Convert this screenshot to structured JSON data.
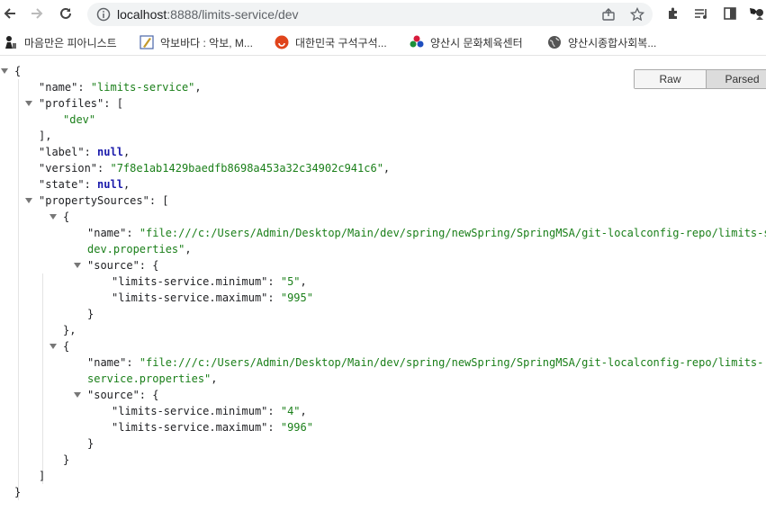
{
  "browser": {
    "url_host": "localhost",
    "url_rest": ":8888/limits-service/dev"
  },
  "bookmarks": [
    {
      "label": "마음만은 피아니스트",
      "icon": "person-icon"
    },
    {
      "label": "악보바다 : 악보, M...",
      "icon": "pen-icon"
    },
    {
      "label": "대한민국 구석구석...",
      "icon": "red-circle-icon"
    },
    {
      "label": "양산시 문화체육센터",
      "icon": "flower-icon"
    },
    {
      "label": "양산시종합사회복...",
      "icon": "globe-icon"
    }
  ],
  "view_toggle": {
    "raw": "Raw",
    "parsed": "Parsed",
    "active": "Parsed"
  },
  "json": {
    "name_key": "\"name\"",
    "name_val": "\"limits-service\"",
    "profiles_key": "\"profiles\"",
    "profiles_0": "\"dev\"",
    "label_key": "\"label\"",
    "label_val": "null",
    "version_key": "\"version\"",
    "version_val": "\"7f8e1ab1429baedfb8698a453a32c34902c941c6\"",
    "state_key": "\"state\"",
    "state_val": "null",
    "ps_key": "\"propertySources\"",
    "src0_name_key": "\"name\"",
    "src0_name_val_1": "\"file:///c:/Users/Admin/Desktop/Main/dev/spring/newSpring/SpringMSA/git-localconfig-repo/limits-serv",
    "src0_name_val_2": "dev.properties\"",
    "src0_source_key": "\"source\"",
    "src0_min_key": "\"limits-service.minimum\"",
    "src0_min_val": "\"5\"",
    "src0_max_key": "\"limits-service.maximum\"",
    "src0_max_val": "\"995\"",
    "src1_name_key": "\"name\"",
    "src1_name_val_1": "\"file:///c:/Users/Admin/Desktop/Main/dev/spring/newSpring/SpringMSA/git-localconfig-repo/limits-",
    "src1_name_val_2": "service.properties\"",
    "src1_source_key": "\"source\"",
    "src1_min_key": "\"limits-service.minimum\"",
    "src1_min_val": "\"4\"",
    "src1_max_key": "\"limits-service.maximum\"",
    "src1_max_val": "\"996\""
  }
}
